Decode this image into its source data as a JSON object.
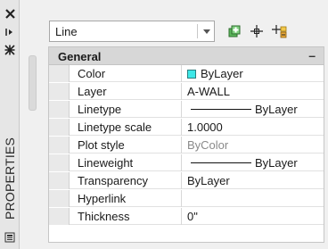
{
  "palette": {
    "title": "PROPERTIES",
    "icons": {
      "close": "close-icon",
      "autohide": "autohide-icon",
      "properties": "properties-icon",
      "menu": "palette-menu-icon"
    }
  },
  "object_selector": {
    "value": "Line"
  },
  "toolbar": {
    "icons": [
      "toggle-pickadd-icon",
      "select-objects-icon",
      "quick-select-icon"
    ]
  },
  "section": {
    "title": "General",
    "collapse_symbol": "–"
  },
  "properties": [
    {
      "label": "Color",
      "value": "ByLayer",
      "kind": "color",
      "swatch_color": "#3ee8e8"
    },
    {
      "label": "Layer",
      "value": "A-WALL",
      "kind": "text"
    },
    {
      "label": "Linetype",
      "value": "ByLayer",
      "kind": "line"
    },
    {
      "label": "Linetype scale",
      "value": "1.0000",
      "kind": "text"
    },
    {
      "label": "Plot style",
      "value": "ByColor",
      "kind": "gray"
    },
    {
      "label": "Lineweight",
      "value": "ByLayer",
      "kind": "line"
    },
    {
      "label": "Transparency",
      "value": "ByLayer",
      "kind": "text"
    },
    {
      "label": "Hyperlink",
      "value": "",
      "kind": "text"
    },
    {
      "label": "Thickness",
      "value": "0\"",
      "kind": "text"
    }
  ]
}
